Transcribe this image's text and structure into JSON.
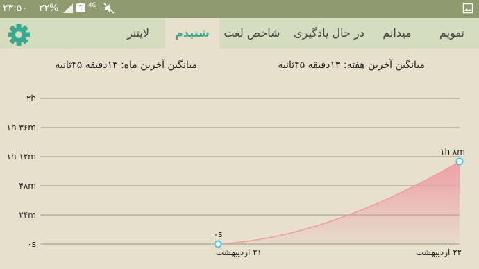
{
  "status_bar": {
    "time": "۲۳:۵۰",
    "battery": "۲۲%",
    "sim_badge": "1",
    "network": "4G",
    "icons": [
      "signal-icon",
      "mute-icon",
      "gallery-icon"
    ]
  },
  "tabs": [
    {
      "label": "تقویم",
      "active": false
    },
    {
      "label": "میدانم",
      "active": false
    },
    {
      "label": "در حال یادگیری",
      "active": false
    },
    {
      "label": "شاخص لغت",
      "active": false
    },
    {
      "label": "شنیدم",
      "active": true
    },
    {
      "label": "لایتنر",
      "active": false
    }
  ],
  "settings_icon": "gear-icon",
  "stats": {
    "week_avg": "میانگین آخرین هفته: ۱۳دقیقه  ۴۵ثانیه",
    "month_avg": "میانگین آخرین ماه: ۱۳دقیقه  ۴۵ثانیه"
  },
  "colors": {
    "accent": "#3aa98f",
    "header": "#8f9a6f",
    "tabbar": "#d5dcbf",
    "background": "#e6e0cd",
    "series": "#ef9aa6",
    "point": "#4fc3e6"
  },
  "chart_data": {
    "type": "area",
    "y_tick_labels": [
      "۰s",
      "۲۴m",
      "۴۸m",
      "۱h ۱۲m",
      "۱h ۳۶m",
      "۲h"
    ],
    "y_ticks_minutes": [
      0,
      24,
      48,
      72,
      96,
      120
    ],
    "ylim_minutes": [
      0,
      120
    ],
    "grid": true,
    "x_tick_labels": [
      "۲۱ اردیبهشت",
      "۲۲ اردیبهشت"
    ],
    "series": [
      {
        "x": [
          "۲۱ اردیبهشت",
          "۲۲ اردیبهشت"
        ],
        "y_minutes": [
          0,
          68
        ],
        "labels": [
          "۰s",
          "۱h ۸m"
        ]
      }
    ]
  }
}
